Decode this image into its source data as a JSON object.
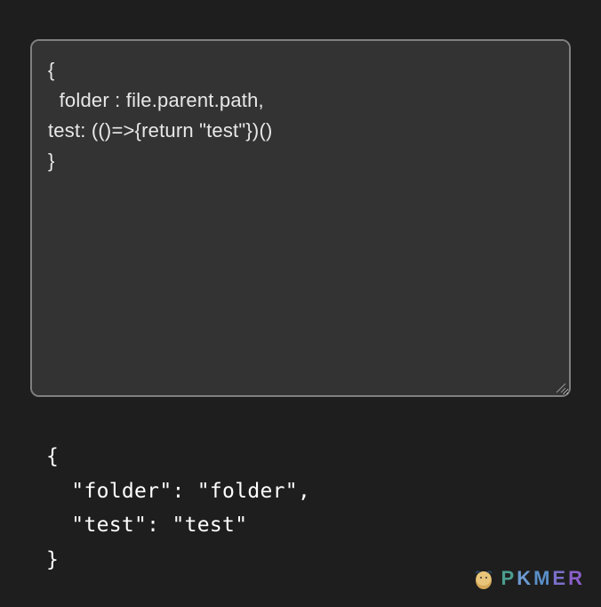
{
  "editor": {
    "code": "{\n  folder : file.parent.path,\ntest: (()=>{return \"test\"})()\n}"
  },
  "output": {
    "json": "{\n  \"folder\": \"folder\",\n  \"test\": \"test\"\n}"
  },
  "watermark": {
    "text": "PKMER"
  },
  "colors": {
    "background": "#1e1e1e",
    "editor_bg": "#333333",
    "editor_border": "#808080",
    "text": "#e0e0e0"
  }
}
